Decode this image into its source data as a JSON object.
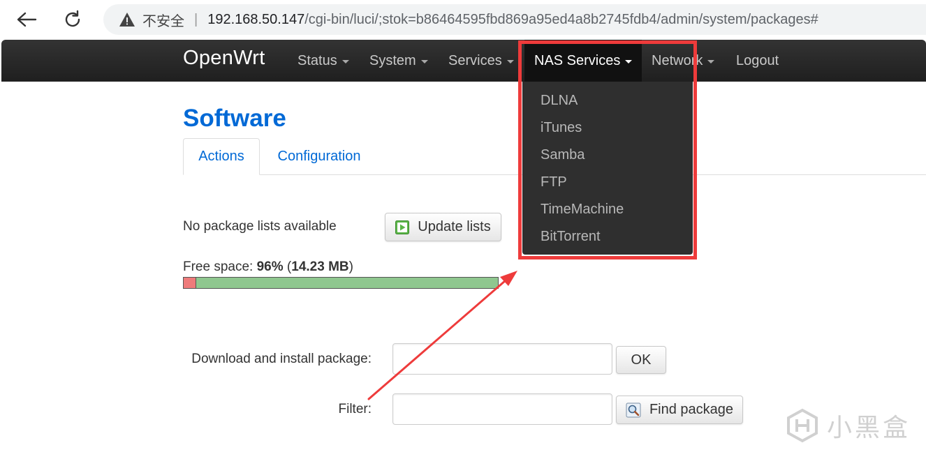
{
  "browser": {
    "security_label": "不安全",
    "url_host": "192.168.50.147",
    "url_path": "/cgi-bin/luci/;stok=b86464595fbd869a95ed4a8b2745fdb4/admin/system/packages#"
  },
  "navbar": {
    "brand": "OpenWrt",
    "menu": [
      {
        "label": "Status"
      },
      {
        "label": "System"
      },
      {
        "label": "Services"
      },
      {
        "label": "NAS Services"
      },
      {
        "label": "Network"
      },
      {
        "label": "Logout"
      }
    ],
    "active_menu": "NAS Services"
  },
  "dropdown": {
    "items": [
      "DLNA",
      "iTunes",
      "Samba",
      "FTP",
      "TimeMachine",
      "BitTorrent"
    ]
  },
  "page": {
    "title": "Software",
    "tabs": [
      {
        "label": "Actions",
        "active": true
      },
      {
        "label": "Configuration",
        "active": false
      }
    ],
    "no_package_lists": "No package lists available",
    "update_lists_button": "Update lists",
    "free_space_label": "Free space:",
    "free_space_percent": "96%",
    "free_space_size": "14.23 MB",
    "free_space_fraction": 0.96,
    "download_label": "Download and install package:",
    "download_value": "",
    "ok_button": "OK",
    "filter_label": "Filter:",
    "filter_value": "",
    "find_package_button": "Find package"
  },
  "colors": {
    "accent": "#0069d6",
    "navbar": "#222222",
    "annotation": "#ee3b3b",
    "bar_free": "#8fc78f",
    "bar_used": "#ee7b7b"
  },
  "watermark": {
    "text": "小黑盒"
  }
}
